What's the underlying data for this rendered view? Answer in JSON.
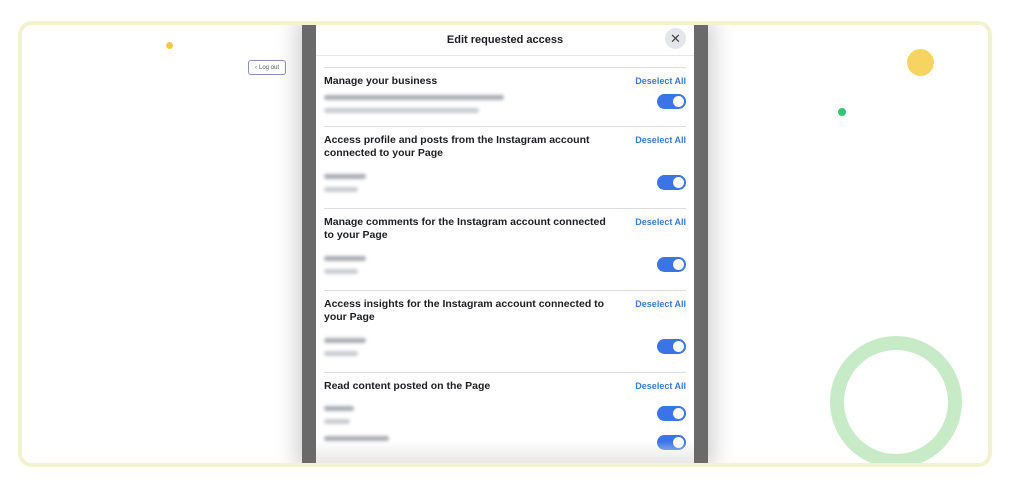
{
  "page": {
    "logout_label": "Log out"
  },
  "dialog": {
    "title": "Edit requested access",
    "close_symbol": "✕",
    "deselect_label": "Deselect All",
    "sections": [
      {
        "title": "Manage your business"
      },
      {
        "title": "Access profile and posts from the Instagram account connected to your Page"
      },
      {
        "title": "Manage comments for the Instagram account connected to your Page"
      },
      {
        "title": "Access insights for the Instagram account connected to your Page"
      },
      {
        "title": "Read content posted on the Page"
      }
    ]
  },
  "colors": {
    "accent": "#3b74e6",
    "link": "#3a7bd5",
    "frame_border": "#f2f2cf"
  }
}
